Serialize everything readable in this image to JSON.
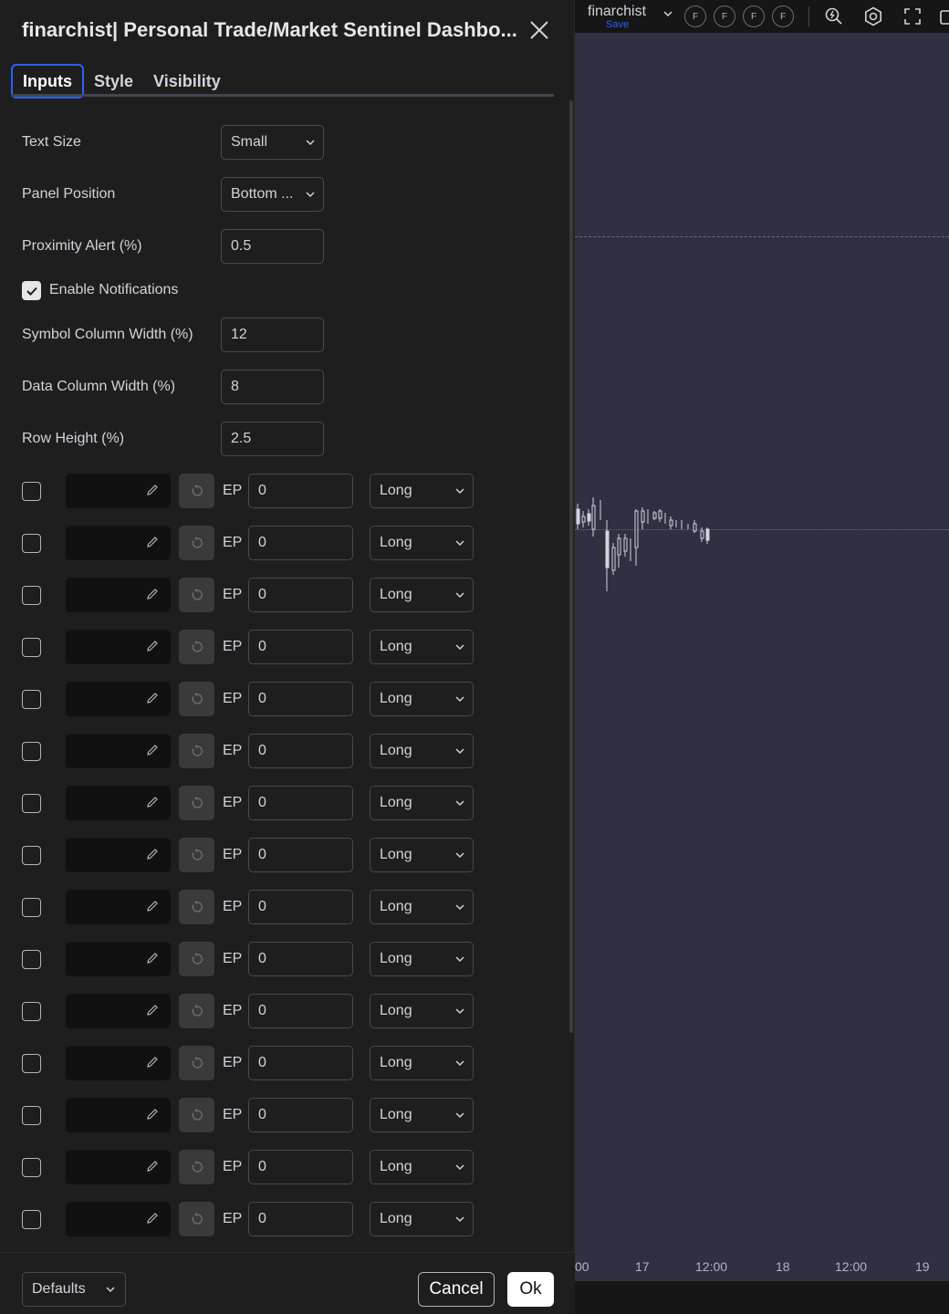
{
  "dialog": {
    "title": "finarchist| Personal Trade/Market Sentinel Dashbo...",
    "tabs": [
      {
        "label": "Inputs",
        "active": true
      },
      {
        "label": "Style",
        "active": false
      },
      {
        "label": "Visibility",
        "active": false
      }
    ],
    "fields": {
      "text_size": {
        "label": "Text Size",
        "value": "Small"
      },
      "panel_position": {
        "label": "Panel Position",
        "value": "Bottom ..."
      },
      "proximity_alert": {
        "label": "Proximity Alert (%)",
        "value": "0.5"
      },
      "enable_notifications": {
        "label": "Enable Notifications",
        "checked": true
      },
      "symbol_col_width": {
        "label": "Symbol Column Width (%)",
        "value": "12"
      },
      "data_col_width": {
        "label": "Data Column Width (%)",
        "value": "8"
      },
      "row_height": {
        "label": "Row Height (%)",
        "value": "2.5"
      }
    },
    "positions": [
      {
        "checked": false,
        "ep_label": "EP",
        "ep_value": "0",
        "side": "Long"
      },
      {
        "checked": false,
        "ep_label": "EP",
        "ep_value": "0",
        "side": "Long"
      },
      {
        "checked": false,
        "ep_label": "EP",
        "ep_value": "0",
        "side": "Long"
      },
      {
        "checked": false,
        "ep_label": "EP",
        "ep_value": "0",
        "side": "Long"
      },
      {
        "checked": false,
        "ep_label": "EP",
        "ep_value": "0",
        "side": "Long"
      },
      {
        "checked": false,
        "ep_label": "EP",
        "ep_value": "0",
        "side": "Long"
      },
      {
        "checked": false,
        "ep_label": "EP",
        "ep_value": "0",
        "side": "Long"
      },
      {
        "checked": false,
        "ep_label": "EP",
        "ep_value": "0",
        "side": "Long"
      },
      {
        "checked": false,
        "ep_label": "EP",
        "ep_value": "0",
        "side": "Long"
      },
      {
        "checked": false,
        "ep_label": "EP",
        "ep_value": "0",
        "side": "Long"
      },
      {
        "checked": false,
        "ep_label": "EP",
        "ep_value": "0",
        "side": "Long"
      },
      {
        "checked": false,
        "ep_label": "EP",
        "ep_value": "0",
        "side": "Long"
      },
      {
        "checked": false,
        "ep_label": "EP",
        "ep_value": "0",
        "side": "Long"
      },
      {
        "checked": false,
        "ep_label": "EP",
        "ep_value": "0",
        "side": "Long"
      },
      {
        "checked": false,
        "ep_label": "EP",
        "ep_value": "0",
        "side": "Long"
      }
    ],
    "footer": {
      "defaults_label": "Defaults",
      "cancel_label": "Cancel",
      "ok_label": "Ok"
    }
  },
  "chart": {
    "layout_name": "finarchist",
    "save_label": "Save",
    "favorites": [
      "F",
      "F",
      "F",
      "F"
    ],
    "toolbar_icons": [
      "quick-search-icon",
      "settings-icon",
      "fullscreen-icon",
      "snapshot-icon"
    ],
    "time_axis": [
      "00",
      "17",
      "12:00",
      "18",
      "12:00",
      "19"
    ]
  },
  "colors": {
    "accent": "#2962ff",
    "chart_bg": "#2f3042",
    "dialog_bg": "#1e1e1e"
  }
}
